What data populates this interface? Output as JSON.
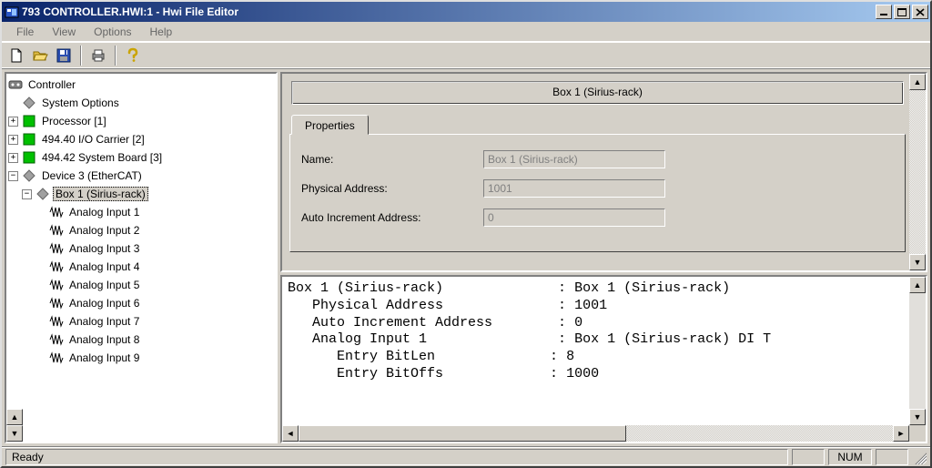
{
  "window": {
    "title": "793 CONTROLLER.HWI:1 - Hwi File Editor"
  },
  "menu": {
    "file": "File",
    "view": "View",
    "options": "Options",
    "help": "Help"
  },
  "toolbar": {
    "new": "new",
    "open": "open",
    "save": "save",
    "print": "print",
    "help": "help"
  },
  "tree": {
    "root": "Controller",
    "system_options": "System Options",
    "processor": "Processor [1]",
    "io_carrier": "494.40 I/O Carrier [2]",
    "system_board": "494.42 System Board [3]",
    "device3": "Device 3 (EtherCAT)",
    "box1": "Box 1 (Sirius-rack)",
    "ai1": "Analog Input 1",
    "ai2": "Analog Input 2",
    "ai3": "Analog Input 3",
    "ai4": "Analog Input 4",
    "ai5": "Analog Input 5",
    "ai6": "Analog Input 6",
    "ai7": "Analog Input 7",
    "ai8": "Analog Input 8",
    "ai9": "Analog Input 9"
  },
  "props": {
    "group_title": "Box 1 (Sirius-rack)",
    "tab": "Properties",
    "name_label": "Name:",
    "name_value": "Box 1 (Sirius-rack)",
    "phys_label": "Physical Address:",
    "phys_value": "1001",
    "auto_label": "Auto Increment Address:",
    "auto_value": "0"
  },
  "output": {
    "l1a": "Box 1 (Sirius-rack)",
    "l1b": "Box 1 (Sirius-rack)",
    "l2a": "   Physical Address",
    "l2b": "1001",
    "l3a": "   Auto Increment Address",
    "l3b": "0",
    "l4a": "   Analog Input 1",
    "l4b": "Box 1 (Sirius-rack) DI T",
    "l5a": "      Entry BitLen",
    "l5b": "8",
    "l6a": "      Entry BitOffs",
    "l6b": "1000"
  },
  "status": {
    "ready": "Ready",
    "num": "NUM"
  }
}
